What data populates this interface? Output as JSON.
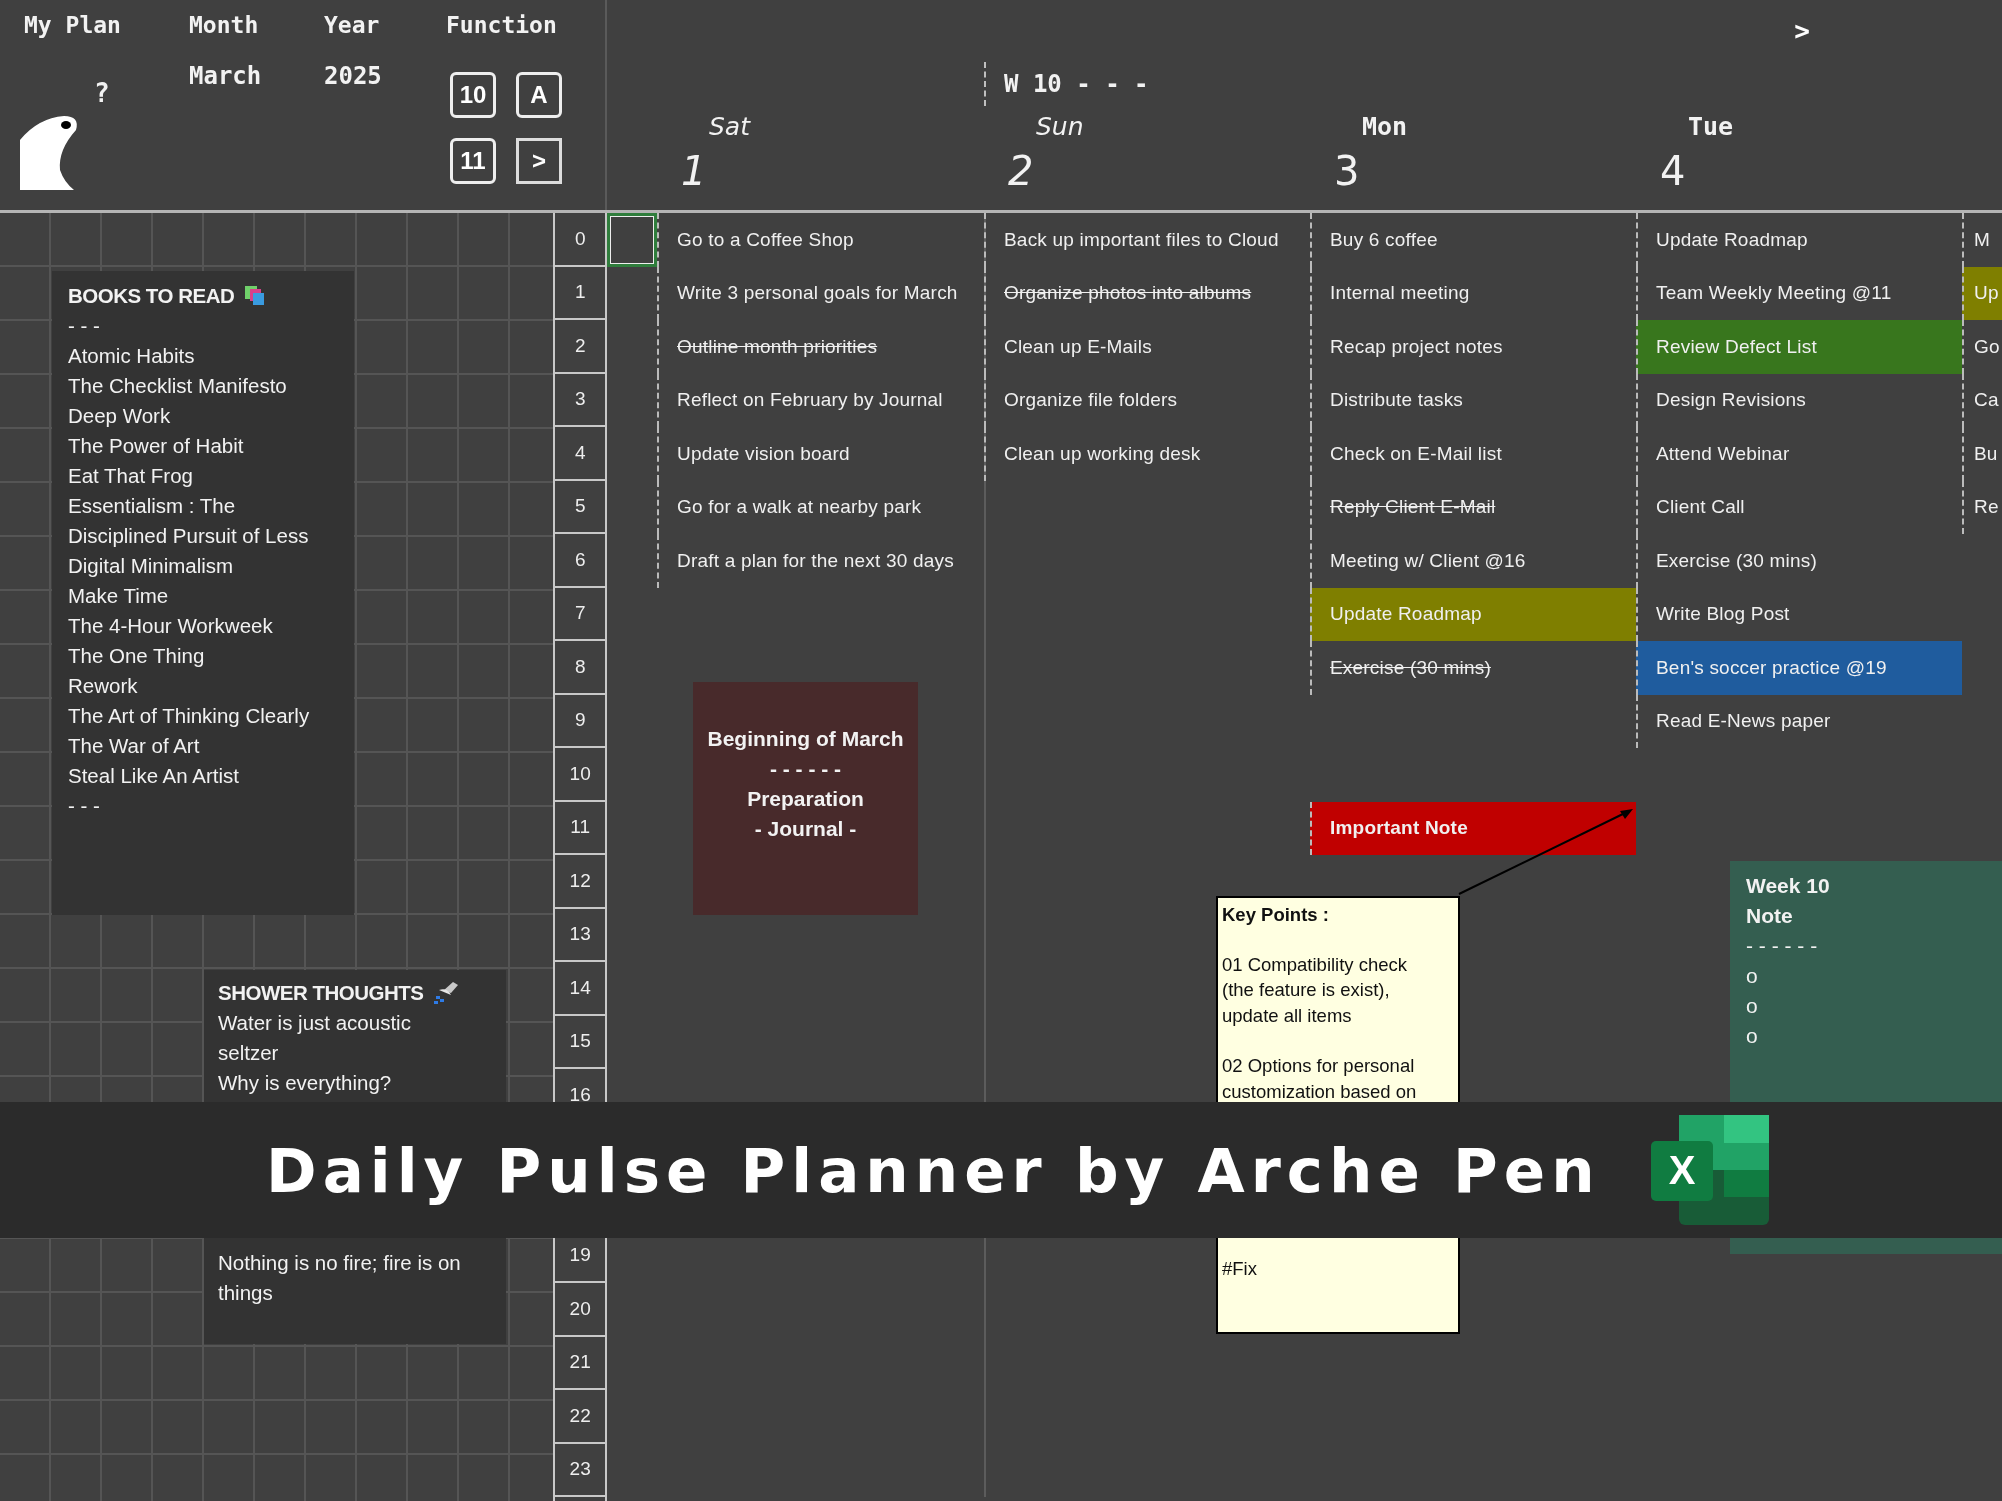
{
  "header": {
    "title": "My Plan",
    "frog_mark": "?",
    "month_label": "Month",
    "month": "March",
    "year_label": "Year",
    "year": "2025",
    "function_label": "Function",
    "function_buttons": [
      {
        "kind": "box",
        "label": "10"
      },
      {
        "kind": "box",
        "label": "A"
      },
      {
        "kind": "box",
        "label": "11"
      },
      {
        "kind": "frame",
        "label": ">"
      }
    ],
    "next": ">",
    "week_label": "W 10 - - -"
  },
  "hours": [
    "0",
    "1",
    "2",
    "3",
    "4",
    "5",
    "6",
    "7",
    "8",
    "9",
    "10",
    "11",
    "12",
    "13",
    "14",
    "15",
    "16",
    "19",
    "20",
    "21",
    "22",
    "23"
  ],
  "days": [
    {
      "name": "Sat",
      "weekend": true,
      "date": "1",
      "tasks": [
        {
          "text": "Go to a Coffee Shop",
          "done": false
        },
        {
          "text": "Write 3 personal goals for March",
          "done": false
        },
        {
          "text": "Outline month priorities",
          "done": true
        },
        {
          "text": "Reflect on February by Journal",
          "done": false
        },
        {
          "text": "Update vision board",
          "done": false
        },
        {
          "text": "Go for a walk at nearby park",
          "done": false
        },
        {
          "text": "Draft a plan for the next 30 days",
          "done": false
        }
      ]
    },
    {
      "name": "Sun",
      "weekend": true,
      "date": "2",
      "tasks": [
        {
          "text": "Back up important files to Cloud",
          "done": false
        },
        {
          "text": "Organize photos into albums",
          "done": true
        },
        {
          "text": "Clean up E-Mails",
          "done": false
        },
        {
          "text": "Organize file folders",
          "done": false
        },
        {
          "text": "Clean up working desk",
          "done": false
        }
      ]
    },
    {
      "name": "Mon",
      "weekend": false,
      "date": "3",
      "tasks": [
        {
          "text": "Buy 6 coffee",
          "done": false
        },
        {
          "text": "Internal meeting",
          "done": false
        },
        {
          "text": "Recap project notes",
          "done": false
        },
        {
          "text": "Distribute tasks",
          "done": false
        },
        {
          "text": "Check on E-Mail list",
          "done": false
        },
        {
          "text": "Reply Client E-Mail",
          "done": true
        },
        {
          "text": "Meeting w/ Client @16",
          "done": false
        },
        {
          "text": "Update Roadmap",
          "done": false,
          "color": "#7f7f00"
        },
        {
          "text": "Exercise (30 mins)",
          "done": true
        }
      ],
      "flag_note": {
        "text": "Important Note",
        "color": "#c00000"
      }
    },
    {
      "name": "Tue",
      "weekend": false,
      "date": "4",
      "tasks": [
        {
          "text": "Update Roadmap",
          "done": false
        },
        {
          "text": "Team Weekly Meeting @11",
          "done": false
        },
        {
          "text": "Review Defect List",
          "done": false,
          "color": "#38761d"
        },
        {
          "text": "Design Revisions",
          "done": false
        },
        {
          "text": "Attend Webinar",
          "done": false
        },
        {
          "text": "Client Call",
          "done": false
        },
        {
          "text": "Exercise (30 mins)",
          "done": false
        },
        {
          "text": "Write Blog Post",
          "done": false
        },
        {
          "text": "Ben's soccer practice @19",
          "done": false,
          "color": "#1f5c9e"
        },
        {
          "text": "Read E-News paper",
          "done": false
        }
      ]
    },
    {
      "tasks": [
        {
          "text": "M",
          "done": false
        },
        {
          "text": "Up",
          "done": false,
          "color": "#7f7f00"
        },
        {
          "text": "Go",
          "done": false
        },
        {
          "text": "Ca",
          "done": false
        },
        {
          "text": "Bu",
          "done": false
        },
        {
          "text": "Re",
          "done": false
        }
      ]
    }
  ],
  "books_note": {
    "title": "BOOKS TO READ",
    "lines": [
      "- - -",
      "Atomic Habits",
      "The Checklist Manifesto",
      "Deep Work",
      "The Power of Habit",
      "Eat That Frog",
      "Essentialism : The",
      "Disciplined Pursuit of Less",
      "Digital Minimalism",
      "Make Time",
      "The 4-Hour Workweek",
      "The One Thing",
      "Rework",
      "The Art of Thinking Clearly",
      "The War of Art",
      "Steal Like An Artist",
      "- - -"
    ]
  },
  "shower_note": {
    "title": "SHOWER THOUGHTS",
    "lines": [
      "Water is just acoustic seltzer",
      "Why is everything?",
      "Nothing is no fire; fire is on things"
    ]
  },
  "march_note": {
    "lines": [
      "Beginning of March",
      "- - - - - -",
      "Preparation",
      "- Journal -"
    ]
  },
  "key_points": {
    "title": "Key Points :",
    "paragraphs": [
      "01 Compatibility check (the feature is exist), update all items",
      "02 Options for personal customization based on",
      "#Fix"
    ]
  },
  "week_note": {
    "lines": [
      "Week 10",
      "Note",
      "- - - - - -",
      "o",
      "o",
      "o"
    ]
  },
  "banner": {
    "title": "Daily Pulse Planner by Arche Pen",
    "logo_letter": "X"
  }
}
